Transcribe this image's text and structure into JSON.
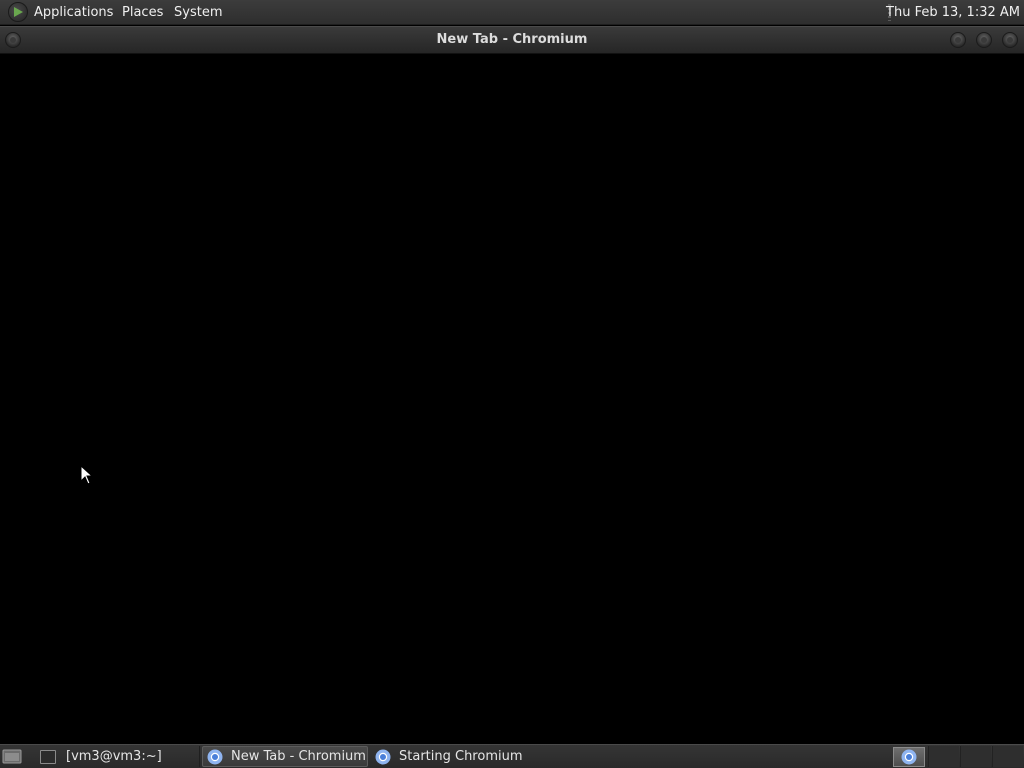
{
  "top_panel": {
    "menus": [
      {
        "label": "Applications"
      },
      {
        "label": "Places"
      },
      {
        "label": "System"
      }
    ],
    "clock": "Thu Feb 13,  1:32 AM",
    "logo_icon": "distro-logo-icon"
  },
  "window": {
    "title": "New Tab - Chromium"
  },
  "taskbar": {
    "show_desktop_icon": "show-desktop-icon",
    "tasks": [
      {
        "label": "[vm3@vm3:~]",
        "icon": "terminal-icon",
        "active": false
      },
      {
        "label": "New Tab - Chromium",
        "icon": "chromium-icon",
        "active": true
      },
      {
        "label": "Starting Chromium",
        "icon": "chromium-icon",
        "active": false
      }
    ]
  },
  "colors": {
    "panel_bg": "#2e2e2e",
    "content_bg": "#000000",
    "text": "#e8e8e8",
    "chromium_blue": "#5b8ee6"
  }
}
